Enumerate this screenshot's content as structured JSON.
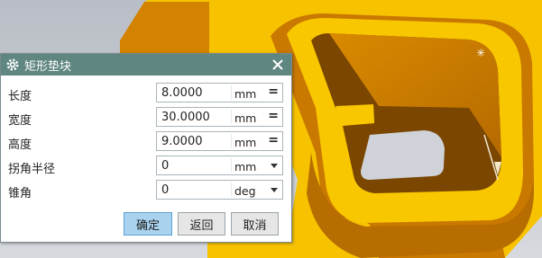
{
  "dialog": {
    "title": "矩形垫块",
    "close_symbol": "✕"
  },
  "fields": [
    {
      "label": "长度",
      "value": "8.0000",
      "unit": "mm",
      "control": "="
    },
    {
      "label": "宽度",
      "value": "30.0000",
      "unit": "mm",
      "control": "="
    },
    {
      "label": "高度",
      "value": "9.0000",
      "unit": "mm",
      "control": "="
    },
    {
      "label": "拐角半径",
      "value": "0",
      "unit": "mm",
      "control": "dropdown"
    },
    {
      "label": "锥角",
      "value": "0",
      "unit": "deg",
      "control": "dropdown"
    }
  ],
  "buttons": {
    "ok": "确定",
    "back": "返回",
    "cancel": "取消"
  },
  "icons": {
    "title": "gear-icon",
    "close": "close-icon",
    "equals": "equals-icon",
    "dropdown": "chevron-down-icon"
  },
  "colors": {
    "titlebar": "#5f8680",
    "primary_button": "#a8d2ee",
    "model_yellow": "#f5c200",
    "model_orange": "#c97800",
    "model_dark": "#7a4600"
  }
}
